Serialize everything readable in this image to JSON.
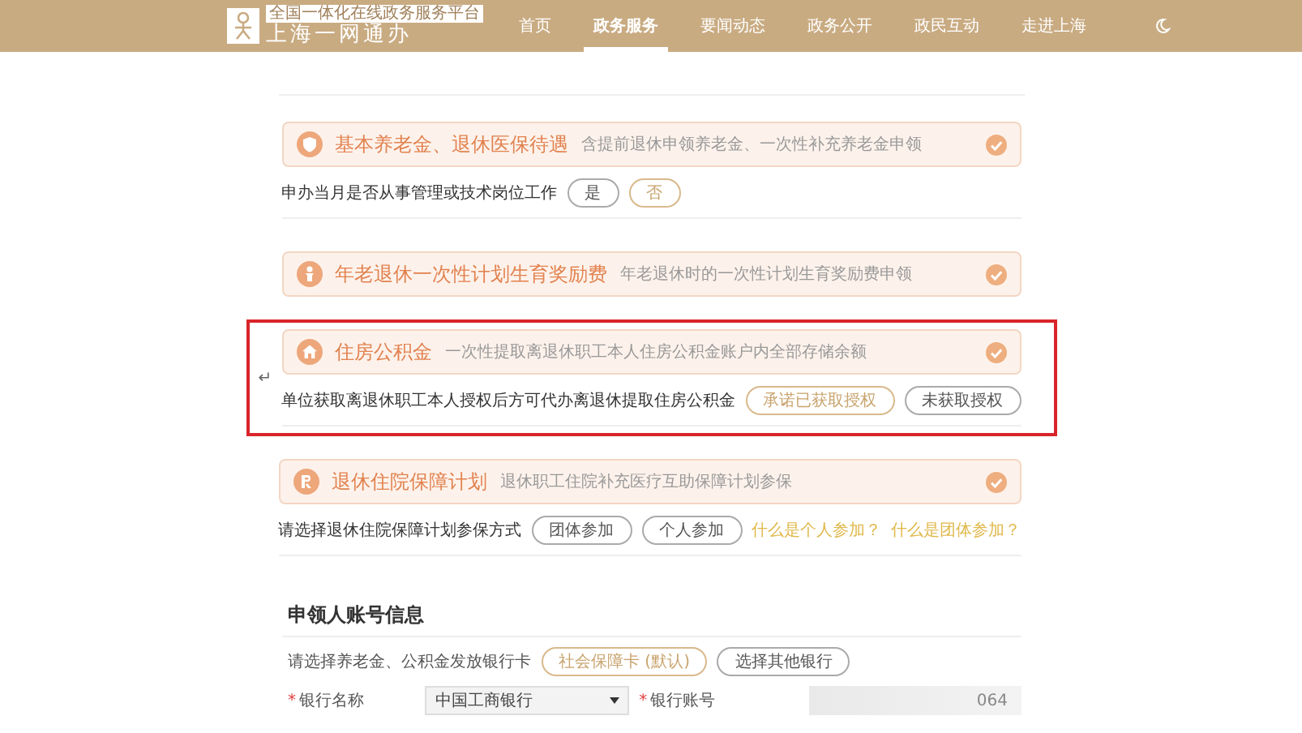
{
  "header": {
    "logo": {
      "tagline": "全国一体化在线政务服务平台",
      "name": "上海一网通办"
    },
    "nav": [
      {
        "label": "首页",
        "selected": false
      },
      {
        "label": "政务服务",
        "selected": true
      },
      {
        "label": "要闻动态",
        "selected": false
      },
      {
        "label": "政务公开",
        "selected": false
      },
      {
        "label": "政民互动",
        "selected": false
      },
      {
        "label": "走进上海",
        "selected": false
      }
    ]
  },
  "items": [
    {
      "title": "基本养老金、退休医保待遇",
      "description": "含提前退休申领养老金、一次性补充养老金申领",
      "checked": true,
      "highlighted": false,
      "question": {
        "label": "申办当月是否从事管理或技术岗位工作",
        "options": [
          {
            "label": "是",
            "selected": false
          },
          {
            "label": "否",
            "selected": true
          }
        ]
      }
    },
    {
      "title": "年老退休一次性计划生育奖励费",
      "description": "年老退休时的一次性计划生育奖励费申领",
      "checked": true,
      "highlighted": false
    },
    {
      "title": "住房公积金",
      "description": "一次性提取离退休职工本人住房公积金账户内全部存储余额",
      "checked": true,
      "highlighted": true,
      "mark": "↵",
      "question": {
        "label": "单位获取离退休职工本人授权后方可代办离退休提取住房公积金",
        "options": [
          {
            "label": "承诺已获取授权",
            "selected": true
          },
          {
            "label": "未获取授权",
            "selected": false
          }
        ]
      }
    },
    {
      "title": "退休住院保障计划",
      "description": "退休职工住院补充医疗互助保障计划参保",
      "checked": true,
      "highlighted": false,
      "question": {
        "label": "请选择退休住院保障计划参保方式",
        "options": [
          {
            "label": "团体参加",
            "selected": false
          },
          {
            "label": "个人参加",
            "selected": false
          }
        ],
        "links": [
          "什么是个人参加？",
          "什么是团体参加？"
        ]
      }
    }
  ],
  "account": {
    "title": "申领人账号信息",
    "card_question": {
      "label": "请选择养老金、公积金发放银行卡",
      "options": [
        {
          "label": "社会保障卡 (默认)",
          "selected": true
        },
        {
          "label": "选择其他银行",
          "selected": false
        }
      ]
    },
    "fields": [
      {
        "kind": "select",
        "label": "银行名称",
        "required_mark": "*",
        "value": "中国工商银行"
      },
      {
        "kind": "masked",
        "label": "银行账号",
        "required_mark": "*",
        "value": "064"
      }
    ]
  }
}
